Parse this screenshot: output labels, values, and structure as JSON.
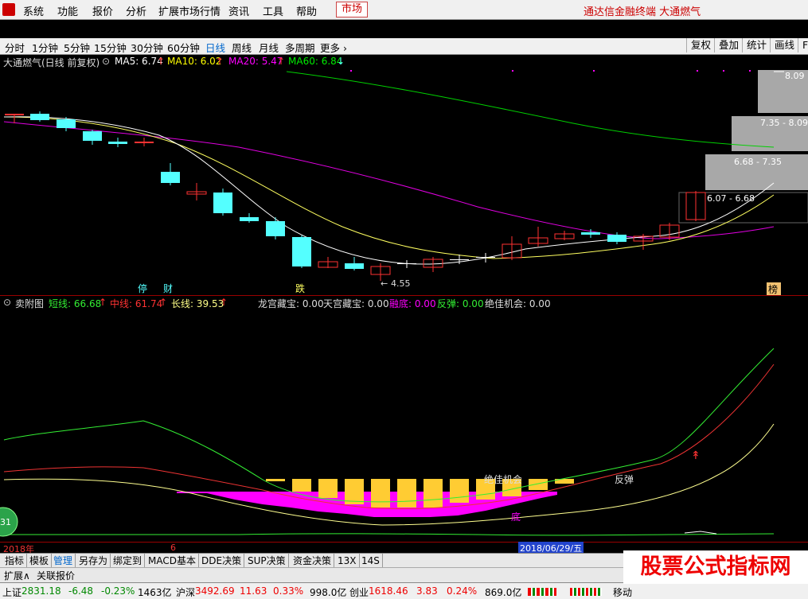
{
  "menu": {
    "items": [
      "系统",
      "功能",
      "报价",
      "分析",
      "扩展市场行情",
      "资讯",
      "工具",
      "帮助"
    ],
    "market": "市场",
    "info": "通达信金融终端 大通燃气"
  },
  "periods": {
    "items": [
      "分时",
      "1分钟",
      "5分钟",
      "15分钟",
      "30分钟",
      "60分钟",
      "日线",
      "周线",
      "月线",
      "多周期",
      "更多"
    ],
    "active": "日线",
    "right": [
      "复权",
      "叠加",
      "统计",
      "画线",
      "F"
    ]
  },
  "main_header": {
    "title": "大通燃气(日线 前复权)",
    "ma5": "MA5: 6.74",
    "ma10": "MA10: 6.02",
    "ma20": "MA20: 5.47",
    "ma60": "MA60: 6.84"
  },
  "main_labels": {
    "low": "4.55",
    "ev1": "停",
    "ev2": "财",
    "ev3": "跌",
    "ev4": "榜",
    "price_boxes": [
      "8.09",
      "7.35 - 8.09",
      "6.68 - 7.35",
      "6.07 - 6.68"
    ]
  },
  "sub_header": {
    "title": "卖附图",
    "short": "短线: 66.68",
    "mid": "中线: 61.74",
    "long": "长线: 39.53",
    "lgcb": "龙宫藏宝: 0.00",
    "tgcb": "天宫藏宝: 0.00",
    "rd": "融底: 0.00",
    "ft": "反弹: 0.00",
    "jjjh": "绝佳机会: 0.00"
  },
  "sub_labels": {
    "jjjh": "绝佳机会",
    "ft": "反弹",
    "di": "底",
    "circle": "31"
  },
  "date_axis": {
    "year": "2018年",
    "month": "6",
    "cursor": "2018/06/29/五"
  },
  "tabs": {
    "items": [
      "指标",
      "模板",
      "管理",
      "另存为",
      "绑定到",
      "MACD基本",
      "DDE决策",
      "SUP决策",
      "资金决策",
      "13X",
      "14S"
    ],
    "active": "管理"
  },
  "subtabs": {
    "expand": "扩展∧",
    "related": "关联报价"
  },
  "status": {
    "sh_name": "上证",
    "sh_val": "2831.18",
    "sh_chg": "-6.48",
    "sh_pct": "-0.23%",
    "sh_amt": "1463亿",
    "sz_name": "沪深",
    "sz_val": "3492.69",
    "sz_chg": "11.63",
    "sz_pct": "0.33%",
    "sz_amt": "998.0亿",
    "cy_name": "创业",
    "cy_val": "1618.46",
    "cy_chg": "3.83",
    "cy_pct": "0.24%",
    "cy_amt": "869.0亿",
    "move": "移动"
  },
  "watermark": "股票公式指标网",
  "colors": {
    "up": "#ff3232",
    "down": "#54ffff",
    "ma5": "#ffffff",
    "ma10": "#ffff00",
    "ma20": "#ff00ff",
    "ma60": "#00e000"
  }
}
